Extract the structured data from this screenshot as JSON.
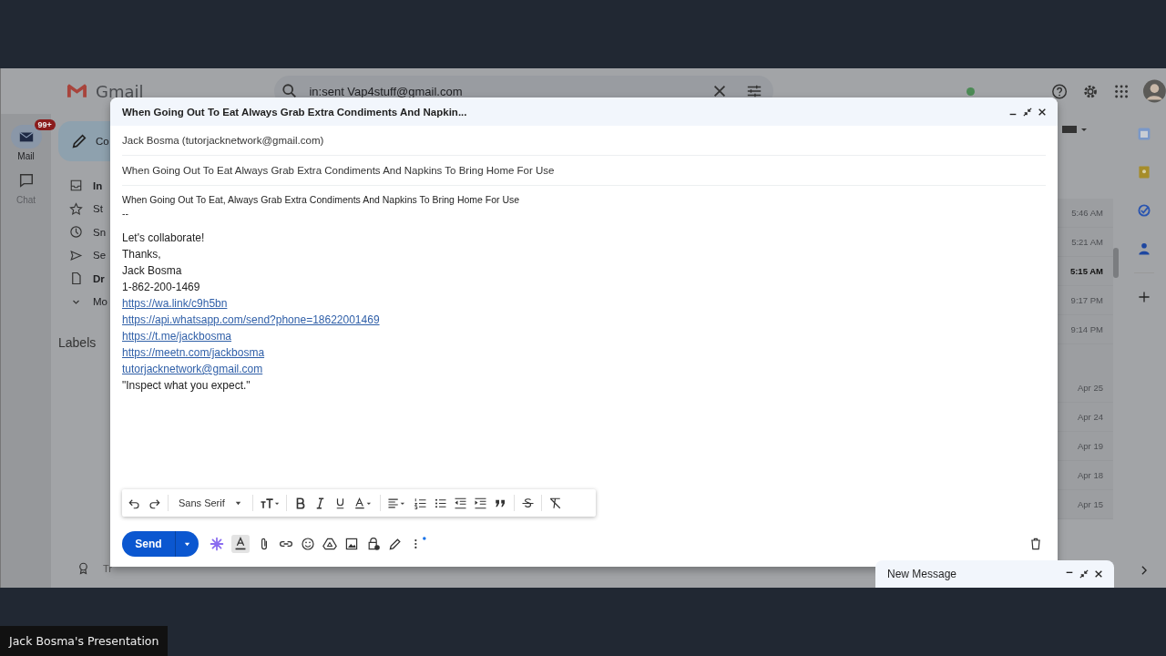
{
  "gmail": {
    "logo": "Gmail",
    "search": {
      "value": "in:sent Vap4stuff@gmail.com"
    },
    "rail": [
      {
        "label": "Mail",
        "badge": "99+",
        "selected": true
      },
      {
        "label": "Chat",
        "selected": false
      }
    ],
    "compose_button": "Co",
    "nav": [
      {
        "label": "In",
        "bold": true
      },
      {
        "label": "St",
        "bold": false
      },
      {
        "label": "Sn",
        "bold": false
      },
      {
        "label": "Se",
        "bold": false
      },
      {
        "label": "Dr",
        "bold": true
      },
      {
        "label": "Mo",
        "bold": false
      }
    ],
    "labels_heading": "Labels",
    "upgrade": "Tr",
    "times": [
      {
        "text": "5:46 AM",
        "unread": false
      },
      {
        "text": "5:21 AM",
        "unread": false
      },
      {
        "text": "5:15 AM",
        "unread": true
      },
      {
        "text": "9:17 PM",
        "unread": false
      },
      {
        "text": "9:14 PM",
        "unread": false
      }
    ],
    "older_times": [
      {
        "text": "Apr 25",
        "unread": false
      },
      {
        "text": "Apr 24",
        "unread": false
      },
      {
        "text": "Apr 19",
        "unread": false
      },
      {
        "text": "Apr 18",
        "unread": false
      },
      {
        "text": "Apr 15",
        "unread": false
      }
    ]
  },
  "compose": {
    "title": "When Going Out To Eat Always Grab Extra Condiments And Napkin...",
    "recipient": "Jack Bosma (tutorjacknetwork@gmail.com)",
    "subject": "When Going Out To Eat Always Grab Extra Condiments And Napkins To Bring Home For Use",
    "body": [
      {
        "kind": "small",
        "text": "When Going Out To Eat, Always Grab Extra Condiments And Napkins To Bring Home For Use"
      },
      {
        "kind": "small",
        "text": "--"
      },
      {
        "kind": "text",
        "text": "Let's collaborate!"
      },
      {
        "kind": "text",
        "text": "Thanks,"
      },
      {
        "kind": "text",
        "text": "Jack Bosma"
      },
      {
        "kind": "text",
        "text": "1-862-200-1469"
      },
      {
        "kind": "link",
        "text": "https://wa.link/c9h5bn"
      },
      {
        "kind": "link",
        "text": "https://api.whatsapp.com/send?phone=18622001469"
      },
      {
        "kind": "link",
        "text": "https://t.me/jackbosma"
      },
      {
        "kind": "link",
        "text": "https://meetn.com/jackbosma"
      },
      {
        "kind": "link",
        "text": "tutorjacknetwork@gmail.com"
      },
      {
        "kind": "text",
        "text": "\"Inspect what you expect.\""
      }
    ],
    "font": "Sans Serif",
    "send": "Send"
  },
  "minimized": {
    "title": "New Message"
  },
  "presentation": {
    "label": "Jack Bosma's Presentation"
  }
}
